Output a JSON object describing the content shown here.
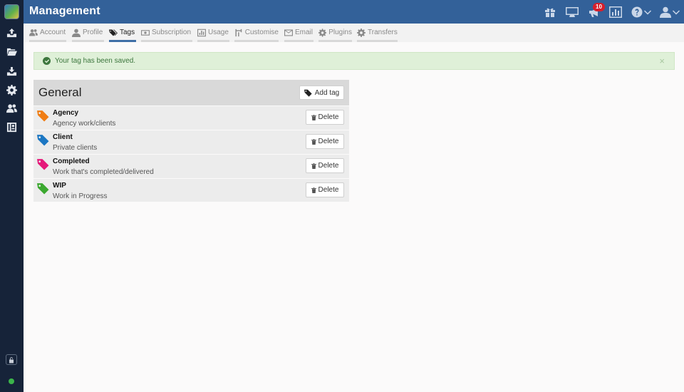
{
  "app": {
    "title": "Management"
  },
  "notifications": {
    "count": "10"
  },
  "tabs": [
    {
      "label": "Account",
      "icon": "users-icon"
    },
    {
      "label": "Profile",
      "icon": "user-icon"
    },
    {
      "label": "Tags",
      "icon": "tags-icon",
      "active": true
    },
    {
      "label": "Subscription",
      "icon": "money-icon"
    },
    {
      "label": "Usage",
      "icon": "bar-chart-icon"
    },
    {
      "label": "Customise",
      "icon": "road-icon"
    },
    {
      "label": "Email",
      "icon": "envelope-icon"
    },
    {
      "label": "Plugins",
      "icon": "cog-icon"
    },
    {
      "label": "Transfers",
      "icon": "cog-icon"
    }
  ],
  "alert": {
    "message": "Your tag has been saved.",
    "close": "×"
  },
  "panel": {
    "title": "General",
    "add_label": "Add tag",
    "delete_label": "Delete",
    "tags": [
      {
        "name": "Agency",
        "description": "Agency work/clients",
        "color": "#f07d13"
      },
      {
        "name": "Client",
        "description": "Private clients",
        "color": "#1c77c3"
      },
      {
        "name": "Completed",
        "description": "Work that's completed/delivered",
        "color": "#e5197a"
      },
      {
        "name": "WIP",
        "description": "Work in Progress",
        "color": "#3ba82f"
      }
    ]
  },
  "colors": {
    "header": "#336199",
    "sidebar": "#162339",
    "active_tab": "#3f6fa6",
    "alert_bg": "#dff0d8",
    "badge": "#d61f2c"
  }
}
